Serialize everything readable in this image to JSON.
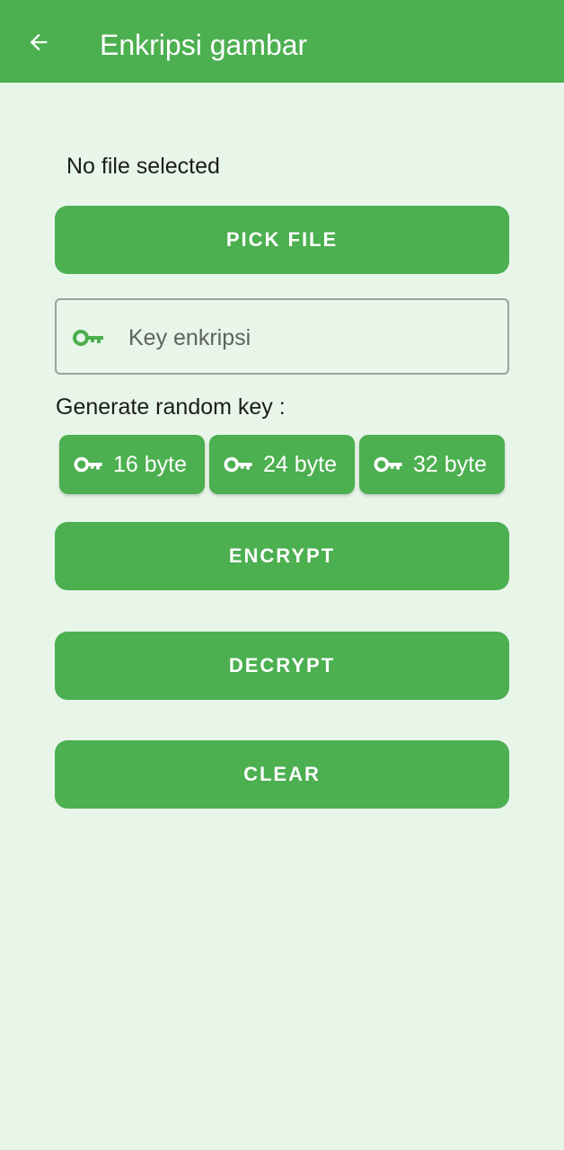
{
  "appbar": {
    "title": "Enkripsi gambar",
    "back_icon": "arrow-left-icon",
    "color": "#4CAF50"
  },
  "file_status": "No file selected",
  "buttons": {
    "pick_file": "PICK FILE",
    "encrypt": "ENCRYPT",
    "decrypt": "DECRYPT",
    "clear": "CLEAR"
  },
  "key_field": {
    "placeholder": "Key enkripsi",
    "value": "",
    "icon": "key-icon"
  },
  "generate": {
    "label": "Generate random key :",
    "chips": [
      {
        "label": "16 byte",
        "icon": "key-icon"
      },
      {
        "label": "24 byte",
        "icon": "key-icon"
      },
      {
        "label": "32 byte",
        "icon": "key-icon"
      }
    ]
  },
  "colors": {
    "accent": "#4CAF50",
    "background": "#E8F5E9"
  }
}
